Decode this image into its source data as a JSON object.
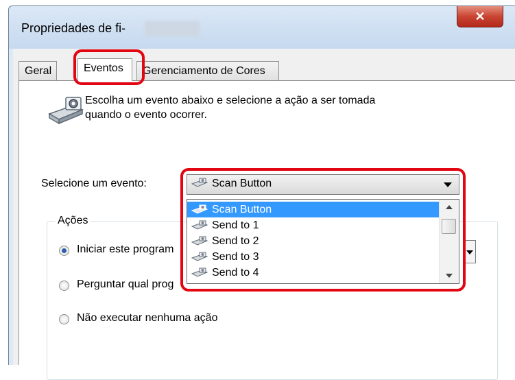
{
  "window": {
    "title": "Propriedades de fi-",
    "close_icon": "close-icon"
  },
  "tabs": [
    {
      "label": "Geral"
    },
    {
      "label": "Eventos"
    },
    {
      "label": "Gerenciamento de Cores"
    }
  ],
  "events": {
    "description_line1": "Escolha um evento abaixo e selecione a ação a ser tomada",
    "description_line2": "quando o evento ocorrer.",
    "select_label": "Selecione um evento:",
    "selected_event": "Scan Button",
    "options": [
      "Scan Button",
      "Send to 1",
      "Send to 2",
      "Send to 3",
      "Send to 4"
    ]
  },
  "actions": {
    "group_title": "Ações",
    "options": [
      {
        "label": "Iniciar este program",
        "checked": true
      },
      {
        "label": "Perguntar qual prog",
        "checked": false
      },
      {
        "label": "Não executar nenhuma ação",
        "checked": false
      }
    ]
  },
  "colors": {
    "highlight": "#e20613",
    "selection": "#3399ff"
  }
}
